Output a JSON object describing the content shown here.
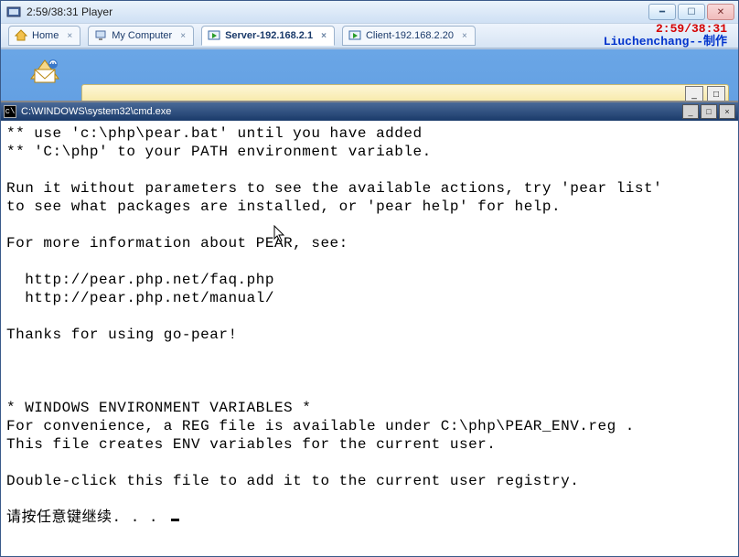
{
  "player": {
    "title": "2:59/38:31 Player"
  },
  "tabs": [
    {
      "label": "Home"
    },
    {
      "label": "My Computer"
    },
    {
      "label": "Server-192.168.2.1"
    },
    {
      "label": "Client-192.168.2.20"
    }
  ],
  "overlay": {
    "timer": "2:59/38:31",
    "author": "Liuchenchang--制作"
  },
  "cmd": {
    "title": "C:\\WINDOWS\\system32\\cmd.exe",
    "lines": "** use 'c:\\php\\pear.bat' until you have added\n** 'C:\\php' to your PATH environment variable.\n\nRun it without parameters to see the available actions, try 'pear list'\nto see what packages are installed, or 'pear help' for help.\n\nFor more information about PEAR, see:\n\n  http://pear.php.net/faq.php\n  http://pear.php.net/manual/\n\nThanks for using go-pear!\n\n\n\n* WINDOWS ENVIRONMENT VARIABLES *\nFor convenience, a REG file is available under C:\\php\\PEAR_ENV.reg .\nThis file creates ENV variables for the current user.\n\nDouble-click this file to add it to the current user registry.\n\n请按任意键继续. . . "
  }
}
